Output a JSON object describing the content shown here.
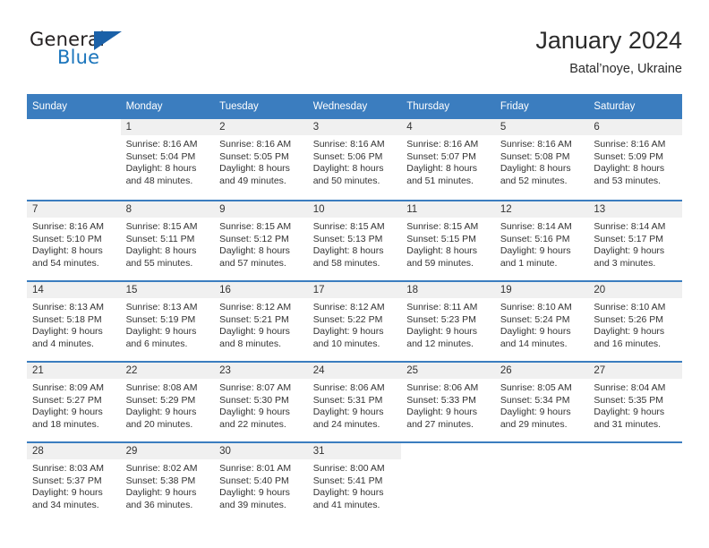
{
  "brand": {
    "name_top": "General",
    "name_bottom": "Blue",
    "triangle_color": "#1b61a8",
    "blue_color": "#1b75bc"
  },
  "header": {
    "title": "January 2024",
    "subtitle": "Batal’noye, Ukraine"
  },
  "theme": {
    "header_blue": "#3b7dbf",
    "row_band_gray": "#f0f0f0",
    "text_color": "#333333"
  },
  "weekdays": [
    "Sunday",
    "Monday",
    "Tuesday",
    "Wednesday",
    "Thursday",
    "Friday",
    "Saturday"
  ],
  "weeks": [
    [
      {
        "day": "",
        "sunrise": "",
        "sunset": "",
        "daylight_line1": "",
        "daylight_line2": ""
      },
      {
        "day": "1",
        "sunrise": "Sunrise: 8:16 AM",
        "sunset": "Sunset: 5:04 PM",
        "daylight_line1": "Daylight: 8 hours",
        "daylight_line2": "and 48 minutes."
      },
      {
        "day": "2",
        "sunrise": "Sunrise: 8:16 AM",
        "sunset": "Sunset: 5:05 PM",
        "daylight_line1": "Daylight: 8 hours",
        "daylight_line2": "and 49 minutes."
      },
      {
        "day": "3",
        "sunrise": "Sunrise: 8:16 AM",
        "sunset": "Sunset: 5:06 PM",
        "daylight_line1": "Daylight: 8 hours",
        "daylight_line2": "and 50 minutes."
      },
      {
        "day": "4",
        "sunrise": "Sunrise: 8:16 AM",
        "sunset": "Sunset: 5:07 PM",
        "daylight_line1": "Daylight: 8 hours",
        "daylight_line2": "and 51 minutes."
      },
      {
        "day": "5",
        "sunrise": "Sunrise: 8:16 AM",
        "sunset": "Sunset: 5:08 PM",
        "daylight_line1": "Daylight: 8 hours",
        "daylight_line2": "and 52 minutes."
      },
      {
        "day": "6",
        "sunrise": "Sunrise: 8:16 AM",
        "sunset": "Sunset: 5:09 PM",
        "daylight_line1": "Daylight: 8 hours",
        "daylight_line2": "and 53 minutes."
      }
    ],
    [
      {
        "day": "7",
        "sunrise": "Sunrise: 8:16 AM",
        "sunset": "Sunset: 5:10 PM",
        "daylight_line1": "Daylight: 8 hours",
        "daylight_line2": "and 54 minutes."
      },
      {
        "day": "8",
        "sunrise": "Sunrise: 8:15 AM",
        "sunset": "Sunset: 5:11 PM",
        "daylight_line1": "Daylight: 8 hours",
        "daylight_line2": "and 55 minutes."
      },
      {
        "day": "9",
        "sunrise": "Sunrise: 8:15 AM",
        "sunset": "Sunset: 5:12 PM",
        "daylight_line1": "Daylight: 8 hours",
        "daylight_line2": "and 57 minutes."
      },
      {
        "day": "10",
        "sunrise": "Sunrise: 8:15 AM",
        "sunset": "Sunset: 5:13 PM",
        "daylight_line1": "Daylight: 8 hours",
        "daylight_line2": "and 58 minutes."
      },
      {
        "day": "11",
        "sunrise": "Sunrise: 8:15 AM",
        "sunset": "Sunset: 5:15 PM",
        "daylight_line1": "Daylight: 8 hours",
        "daylight_line2": "and 59 minutes."
      },
      {
        "day": "12",
        "sunrise": "Sunrise: 8:14 AM",
        "sunset": "Sunset: 5:16 PM",
        "daylight_line1": "Daylight: 9 hours",
        "daylight_line2": "and 1 minute."
      },
      {
        "day": "13",
        "sunrise": "Sunrise: 8:14 AM",
        "sunset": "Sunset: 5:17 PM",
        "daylight_line1": "Daylight: 9 hours",
        "daylight_line2": "and 3 minutes."
      }
    ],
    [
      {
        "day": "14",
        "sunrise": "Sunrise: 8:13 AM",
        "sunset": "Sunset: 5:18 PM",
        "daylight_line1": "Daylight: 9 hours",
        "daylight_line2": "and 4 minutes."
      },
      {
        "day": "15",
        "sunrise": "Sunrise: 8:13 AM",
        "sunset": "Sunset: 5:19 PM",
        "daylight_line1": "Daylight: 9 hours",
        "daylight_line2": "and 6 minutes."
      },
      {
        "day": "16",
        "sunrise": "Sunrise: 8:12 AM",
        "sunset": "Sunset: 5:21 PM",
        "daylight_line1": "Daylight: 9 hours",
        "daylight_line2": "and 8 minutes."
      },
      {
        "day": "17",
        "sunrise": "Sunrise: 8:12 AM",
        "sunset": "Sunset: 5:22 PM",
        "daylight_line1": "Daylight: 9 hours",
        "daylight_line2": "and 10 minutes."
      },
      {
        "day": "18",
        "sunrise": "Sunrise: 8:11 AM",
        "sunset": "Sunset: 5:23 PM",
        "daylight_line1": "Daylight: 9 hours",
        "daylight_line2": "and 12 minutes."
      },
      {
        "day": "19",
        "sunrise": "Sunrise: 8:10 AM",
        "sunset": "Sunset: 5:24 PM",
        "daylight_line1": "Daylight: 9 hours",
        "daylight_line2": "and 14 minutes."
      },
      {
        "day": "20",
        "sunrise": "Sunrise: 8:10 AM",
        "sunset": "Sunset: 5:26 PM",
        "daylight_line1": "Daylight: 9 hours",
        "daylight_line2": "and 16 minutes."
      }
    ],
    [
      {
        "day": "21",
        "sunrise": "Sunrise: 8:09 AM",
        "sunset": "Sunset: 5:27 PM",
        "daylight_line1": "Daylight: 9 hours",
        "daylight_line2": "and 18 minutes."
      },
      {
        "day": "22",
        "sunrise": "Sunrise: 8:08 AM",
        "sunset": "Sunset: 5:29 PM",
        "daylight_line1": "Daylight: 9 hours",
        "daylight_line2": "and 20 minutes."
      },
      {
        "day": "23",
        "sunrise": "Sunrise: 8:07 AM",
        "sunset": "Sunset: 5:30 PM",
        "daylight_line1": "Daylight: 9 hours",
        "daylight_line2": "and 22 minutes."
      },
      {
        "day": "24",
        "sunrise": "Sunrise: 8:06 AM",
        "sunset": "Sunset: 5:31 PM",
        "daylight_line1": "Daylight: 9 hours",
        "daylight_line2": "and 24 minutes."
      },
      {
        "day": "25",
        "sunrise": "Sunrise: 8:06 AM",
        "sunset": "Sunset: 5:33 PM",
        "daylight_line1": "Daylight: 9 hours",
        "daylight_line2": "and 27 minutes."
      },
      {
        "day": "26",
        "sunrise": "Sunrise: 8:05 AM",
        "sunset": "Sunset: 5:34 PM",
        "daylight_line1": "Daylight: 9 hours",
        "daylight_line2": "and 29 minutes."
      },
      {
        "day": "27",
        "sunrise": "Sunrise: 8:04 AM",
        "sunset": "Sunset: 5:35 PM",
        "daylight_line1": "Daylight: 9 hours",
        "daylight_line2": "and 31 minutes."
      }
    ],
    [
      {
        "day": "28",
        "sunrise": "Sunrise: 8:03 AM",
        "sunset": "Sunset: 5:37 PM",
        "daylight_line1": "Daylight: 9 hours",
        "daylight_line2": "and 34 minutes."
      },
      {
        "day": "29",
        "sunrise": "Sunrise: 8:02 AM",
        "sunset": "Sunset: 5:38 PM",
        "daylight_line1": "Daylight: 9 hours",
        "daylight_line2": "and 36 minutes."
      },
      {
        "day": "30",
        "sunrise": "Sunrise: 8:01 AM",
        "sunset": "Sunset: 5:40 PM",
        "daylight_line1": "Daylight: 9 hours",
        "daylight_line2": "and 39 minutes."
      },
      {
        "day": "31",
        "sunrise": "Sunrise: 8:00 AM",
        "sunset": "Sunset: 5:41 PM",
        "daylight_line1": "Daylight: 9 hours",
        "daylight_line2": "and 41 minutes."
      },
      {
        "day": "",
        "sunrise": "",
        "sunset": "",
        "daylight_line1": "",
        "daylight_line2": ""
      },
      {
        "day": "",
        "sunrise": "",
        "sunset": "",
        "daylight_line1": "",
        "daylight_line2": ""
      },
      {
        "day": "",
        "sunrise": "",
        "sunset": "",
        "daylight_line1": "",
        "daylight_line2": ""
      }
    ]
  ]
}
